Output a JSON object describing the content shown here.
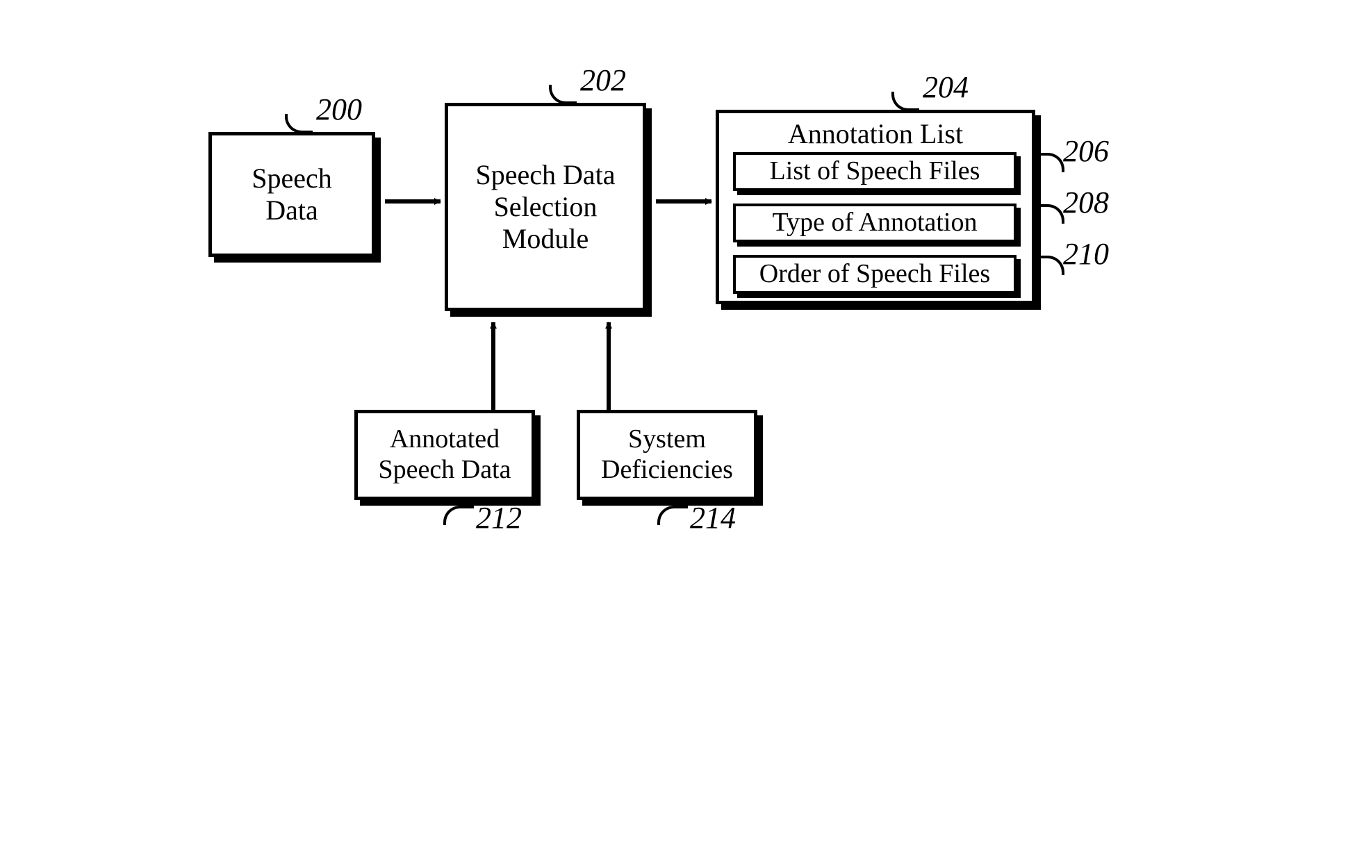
{
  "boxes": {
    "speech_data": {
      "label": "Speech\nData",
      "ref": "200"
    },
    "selection_module": {
      "label": "Speech Data\nSelection\nModule",
      "ref": "202"
    },
    "annotation_list": {
      "title": "Annotation List",
      "ref": "204"
    },
    "list_of_files": {
      "label": "List of Speech Files",
      "ref": "206"
    },
    "type_of_annotation": {
      "label": "Type of Annotation",
      "ref": "208"
    },
    "order_of_files": {
      "label": "Order of Speech Files",
      "ref": "210"
    },
    "annotated_speech": {
      "label": "Annotated\nSpeech Data",
      "ref": "212"
    },
    "system_deficiencies": {
      "label": "System\nDeficiencies",
      "ref": "214"
    }
  }
}
